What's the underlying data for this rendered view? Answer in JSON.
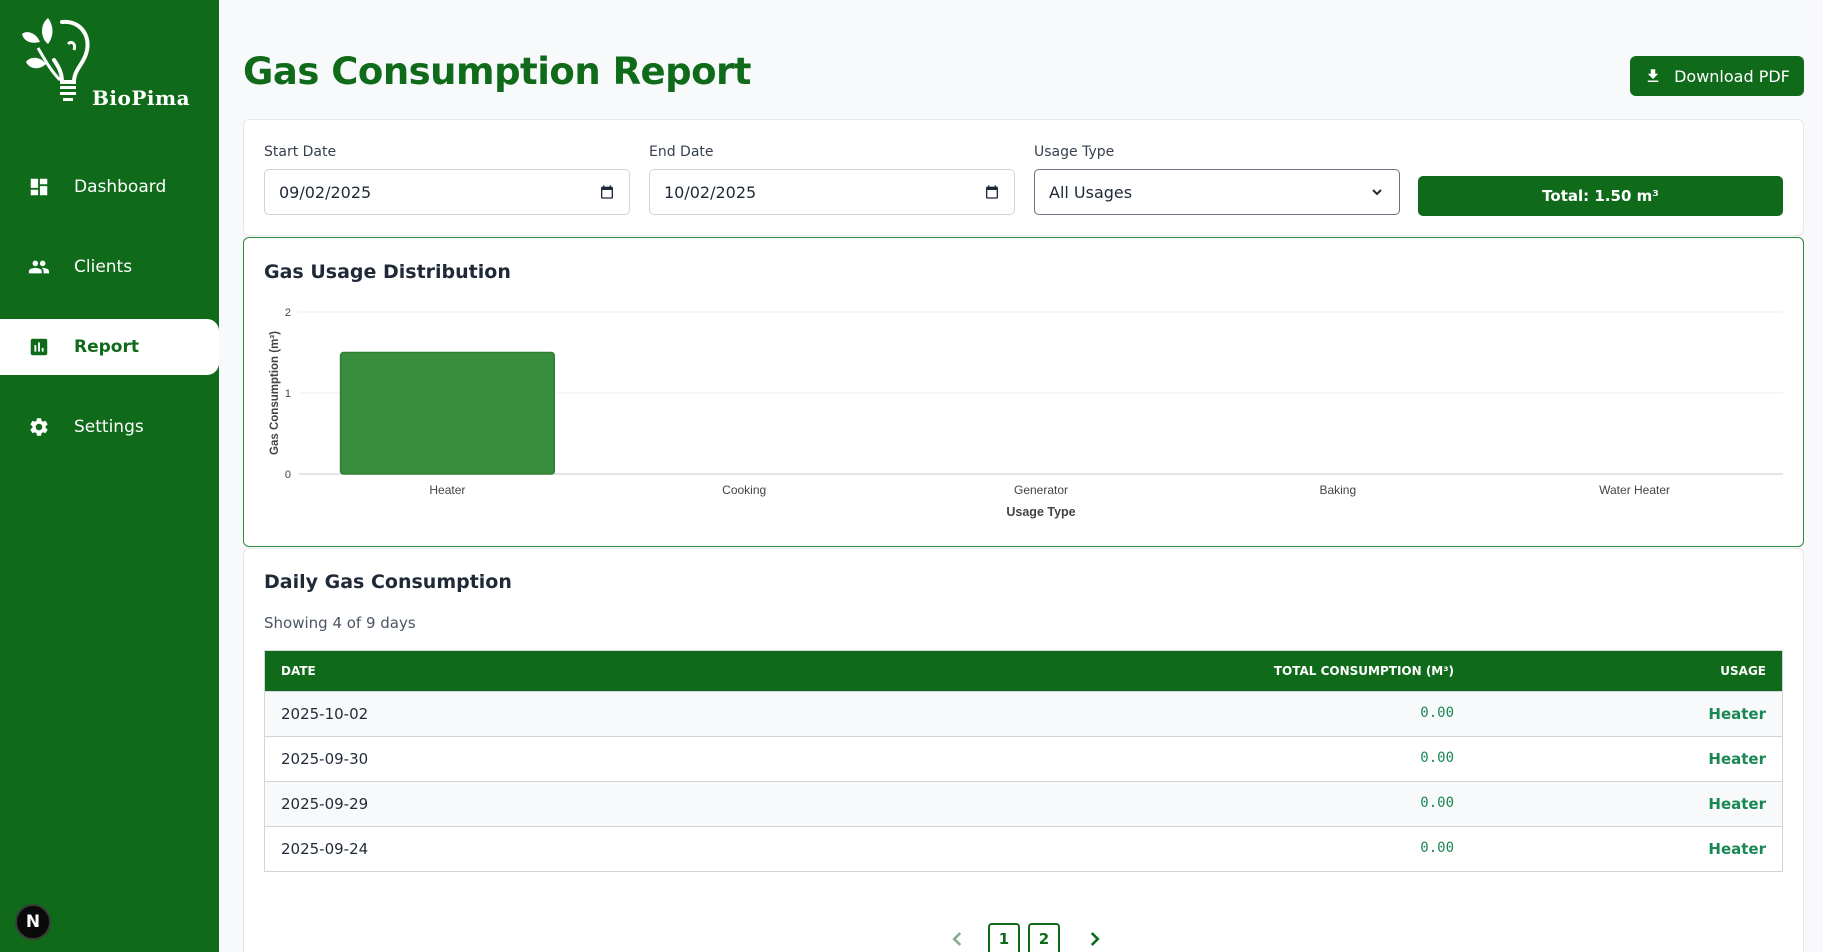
{
  "app": {
    "brand": "BioPima"
  },
  "sidebar": {
    "items": [
      {
        "label": "Dashboard",
        "icon": "dashboard-icon",
        "active": false
      },
      {
        "label": "Clients",
        "icon": "people-icon",
        "active": false
      },
      {
        "label": "Report",
        "icon": "bar-chart-icon",
        "active": true
      },
      {
        "label": "Settings",
        "icon": "gear-icon",
        "active": false
      }
    ],
    "badge": "N"
  },
  "header": {
    "title": "Gas Consumption Report",
    "download_label": "Download PDF"
  },
  "filters": {
    "start_label": "Start Date",
    "start_value": "09/02/2025",
    "end_label": "End Date",
    "end_value": "10/02/2025",
    "usage_label": "Usage Type",
    "usage_value": "All Usages",
    "total": "Total: 1.50 m³"
  },
  "chart_card": {
    "title": "Gas Usage Distribution"
  },
  "chart_data": {
    "type": "bar",
    "categories": [
      "Heater",
      "Cooking",
      "Generator",
      "Baking",
      "Water Heater"
    ],
    "values": [
      1.5,
      0,
      0,
      0,
      0
    ],
    "xlabel": "Usage Type",
    "ylabel": "Gas Consumption (m³)",
    "ylim": [
      0,
      2
    ],
    "yticks": [
      "0",
      "1",
      "2"
    ],
    "grid": true,
    "bar_color": "#388e3c"
  },
  "table_card": {
    "title": "Daily Gas Consumption",
    "subtitle": "Showing 4 of 9 days",
    "columns": [
      "DATE",
      "TOTAL CONSUMPTION (M³)",
      "USAGE"
    ],
    "rows": [
      {
        "date": "2025-10-02",
        "consumption": "0.00",
        "usage": "Heater"
      },
      {
        "date": "2025-09-30",
        "consumption": "0.00",
        "usage": "Heater"
      },
      {
        "date": "2025-09-29",
        "consumption": "0.00",
        "usage": "Heater"
      },
      {
        "date": "2025-09-24",
        "consumption": "0.00",
        "usage": "Heater"
      }
    ],
    "pages": [
      "1",
      "2"
    ]
  },
  "colors": {
    "brand": "#0f6a1a",
    "accent": "#198754"
  }
}
